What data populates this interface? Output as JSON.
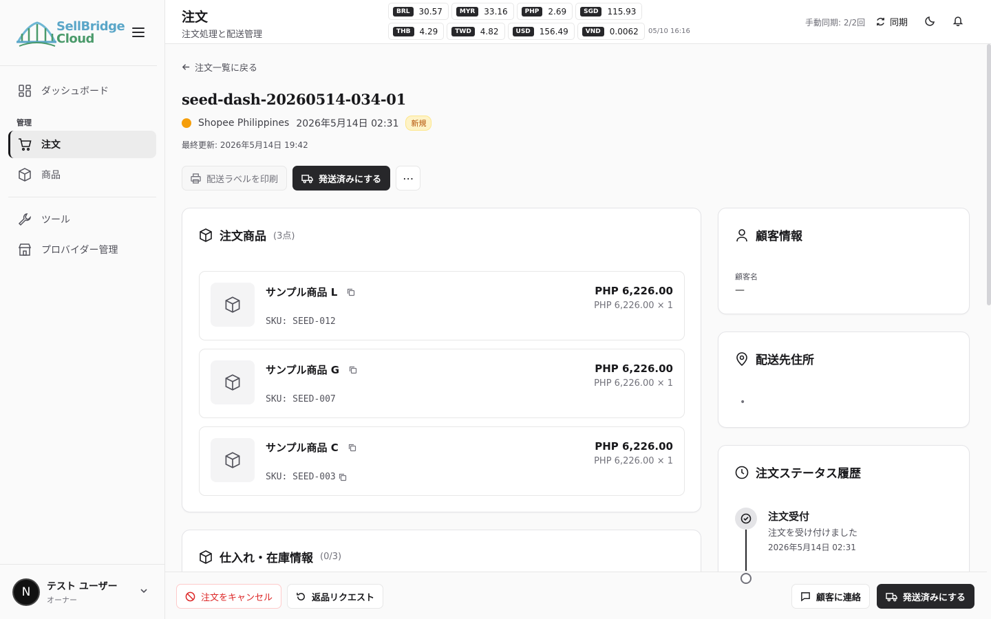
{
  "app": {
    "logo_line1": "SellBridge",
    "logo_line2": "Cloud"
  },
  "sidebar": {
    "items": [
      {
        "label": "ダッシュボード",
        "icon": "dashboard-icon"
      },
      {
        "label": "注文",
        "icon": "cart-icon"
      },
      {
        "label": "商品",
        "icon": "package-icon"
      },
      {
        "label": "ツール",
        "icon": "wrench-icon"
      },
      {
        "label": "プロバイダー管理",
        "icon": "store-icon"
      }
    ],
    "section_label": "管理",
    "user": {
      "initial": "N",
      "name": "テスト ユーザー",
      "role": "オーナー"
    }
  },
  "header": {
    "title": "注文",
    "subtitle": "注文処理と配送管理",
    "rates": [
      {
        "code": "BRL",
        "value": "30.57"
      },
      {
        "code": "MYR",
        "value": "33.16"
      },
      {
        "code": "PHP",
        "value": "2.69"
      },
      {
        "code": "SGD",
        "value": "115.93"
      },
      {
        "code": "THB",
        "value": "4.29"
      },
      {
        "code": "TWD",
        "value": "4.82"
      },
      {
        "code": "USD",
        "value": "156.49"
      },
      {
        "code": "VND",
        "value": "0.0062"
      }
    ],
    "rates_time": "05/10 16:16",
    "sync_count": "手動同期: 2/2回",
    "sync_label": "同期"
  },
  "order": {
    "back_label": "注文一覧に戻る",
    "id": "seed-dash-20260514-034-01",
    "shop": "Shopee Philippines",
    "date": "2026年5月14日 02:31",
    "status_badge": "新規",
    "last_update": "最終更新: 2026年5月14日 19:42",
    "actions": {
      "print_label": "配送ラベルを印刷",
      "mark_shipped": "発送済みにする"
    }
  },
  "items_card": {
    "title": "注文商品",
    "count": "(3点)",
    "items": [
      {
        "name": "サンプル商品 L",
        "sku": "SKU: SEED-012",
        "price": "PHP 6,226.00",
        "unit": "PHP 6,226.00 × 1"
      },
      {
        "name": "サンプル商品 G",
        "sku": "SKU: SEED-007",
        "price": "PHP 6,226.00",
        "unit": "PHP 6,226.00 × 1"
      },
      {
        "name": "サンプル商品 C",
        "sku": "SKU: SEED-003",
        "price": "PHP 6,226.00",
        "unit": "PHP 6,226.00 × 1"
      }
    ]
  },
  "stock_card": {
    "title": "仕入れ・在庫情報",
    "count": "(0/3)"
  },
  "customer_card": {
    "title": "顧客情報",
    "name_label": "顧客名",
    "name_value": "—"
  },
  "address_card": {
    "title": "配送先住所",
    "value": "•"
  },
  "status_card": {
    "title": "注文ステータス履歴",
    "events": [
      {
        "title": "注文受付",
        "desc": "注文を受け付けました",
        "time": "2026年5月14日 02:31"
      }
    ]
  },
  "bottom_bar": {
    "cancel_label": "注文をキャンセル",
    "return_label": "返品リクエスト",
    "contact_label": "顧客に連絡",
    "ship_label": "発送済みにする"
  },
  "colors": {
    "primary": "#27272a",
    "danger": "#dc2626",
    "badge_bg": "#fef3c7",
    "badge_text": "#b45309",
    "shop_dot": "#f59e0b"
  }
}
